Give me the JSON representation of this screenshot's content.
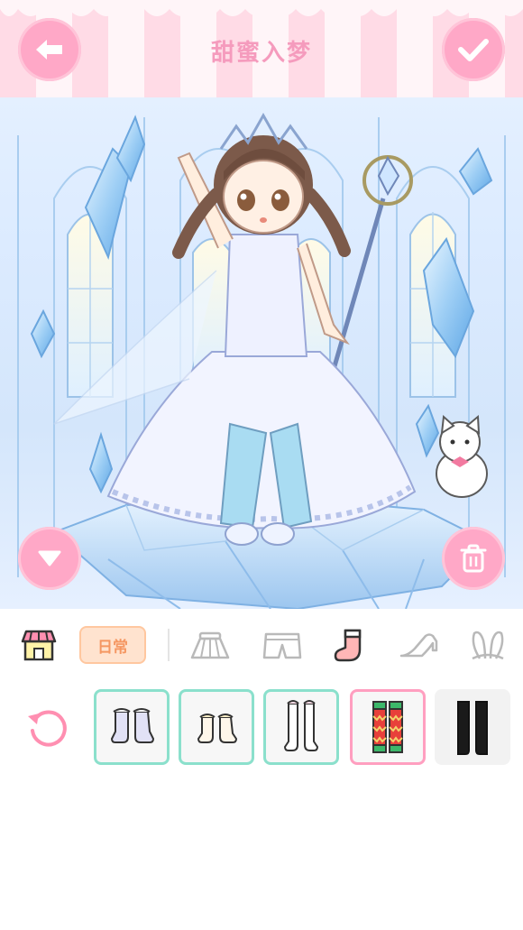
{
  "header": {
    "title": "甜蜜入梦",
    "back_icon": "arrow-left-icon",
    "confirm_icon": "checkmark-icon"
  },
  "scene": {
    "collapse_icon": "triangle-down-icon",
    "delete_icon": "trash-icon"
  },
  "toolbar": {
    "shop_icon": "shop-icon",
    "category_tag": "日常",
    "tabs": [
      {
        "icon": "skirt-icon",
        "selected": false
      },
      {
        "icon": "shorts-icon",
        "selected": false
      },
      {
        "icon": "sock-icon",
        "selected": true
      },
      {
        "icon": "high-heel-icon",
        "selected": false
      },
      {
        "icon": "bunny-ears-icon",
        "selected": false
      }
    ]
  },
  "items": {
    "reset_icon": "reset-icon",
    "slots": [
      {
        "name": "lavender-ruffle-ankle-socks",
        "state": "available"
      },
      {
        "name": "cream-ruffle-ankle-socks",
        "state": "available"
      },
      {
        "name": "white-lace-knee-socks",
        "state": "available"
      },
      {
        "name": "red-green-knit-socks",
        "state": "selected"
      },
      {
        "name": "black-thigh-high-socks",
        "state": "unframed"
      }
    ]
  },
  "colors": {
    "pink_accent": "#ffa8c7",
    "title_pink": "#f59bbd",
    "frame_green": "#8be0cc",
    "frame_pink": "#ff9fc0",
    "tag_orange": "#f59762"
  }
}
